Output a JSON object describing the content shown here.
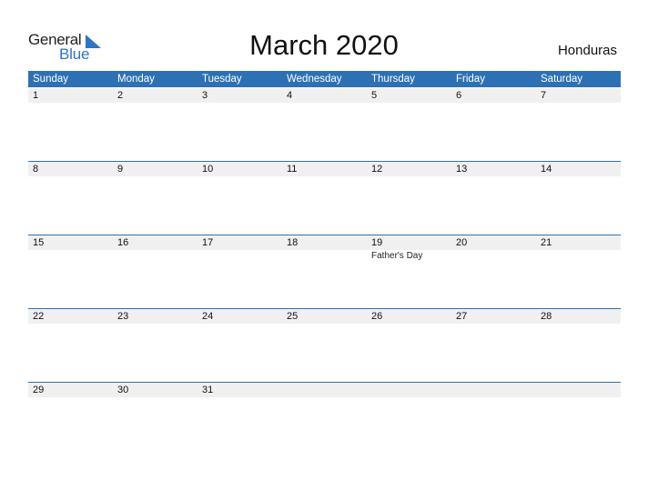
{
  "logo": {
    "part1": "General",
    "part2": "Blue",
    "icon": "triangle-flag-icon",
    "accent": "#2e75c6"
  },
  "title": "March 2020",
  "country": "Honduras",
  "colors": {
    "header_bg": "#2e70b4",
    "band_bg": "#f0f0f0"
  },
  "weekdays": [
    "Sunday",
    "Monday",
    "Tuesday",
    "Wednesday",
    "Thursday",
    "Friday",
    "Saturday"
  ],
  "weeks": [
    {
      "days": [
        {
          "num": "1",
          "event": ""
        },
        {
          "num": "2",
          "event": ""
        },
        {
          "num": "3",
          "event": ""
        },
        {
          "num": "4",
          "event": ""
        },
        {
          "num": "5",
          "event": ""
        },
        {
          "num": "6",
          "event": ""
        },
        {
          "num": "7",
          "event": ""
        }
      ]
    },
    {
      "days": [
        {
          "num": "8",
          "event": ""
        },
        {
          "num": "9",
          "event": ""
        },
        {
          "num": "10",
          "event": ""
        },
        {
          "num": "11",
          "event": ""
        },
        {
          "num": "12",
          "event": ""
        },
        {
          "num": "13",
          "event": ""
        },
        {
          "num": "14",
          "event": ""
        }
      ]
    },
    {
      "days": [
        {
          "num": "15",
          "event": ""
        },
        {
          "num": "16",
          "event": ""
        },
        {
          "num": "17",
          "event": ""
        },
        {
          "num": "18",
          "event": ""
        },
        {
          "num": "19",
          "event": "Father's Day"
        },
        {
          "num": "20",
          "event": ""
        },
        {
          "num": "21",
          "event": ""
        }
      ]
    },
    {
      "days": [
        {
          "num": "22",
          "event": ""
        },
        {
          "num": "23",
          "event": ""
        },
        {
          "num": "24",
          "event": ""
        },
        {
          "num": "25",
          "event": ""
        },
        {
          "num": "26",
          "event": ""
        },
        {
          "num": "27",
          "event": ""
        },
        {
          "num": "28",
          "event": ""
        }
      ]
    },
    {
      "days": [
        {
          "num": "29",
          "event": ""
        },
        {
          "num": "30",
          "event": ""
        },
        {
          "num": "31",
          "event": ""
        },
        {
          "num": "",
          "event": ""
        },
        {
          "num": "",
          "event": ""
        },
        {
          "num": "",
          "event": ""
        },
        {
          "num": "",
          "event": ""
        }
      ]
    }
  ]
}
